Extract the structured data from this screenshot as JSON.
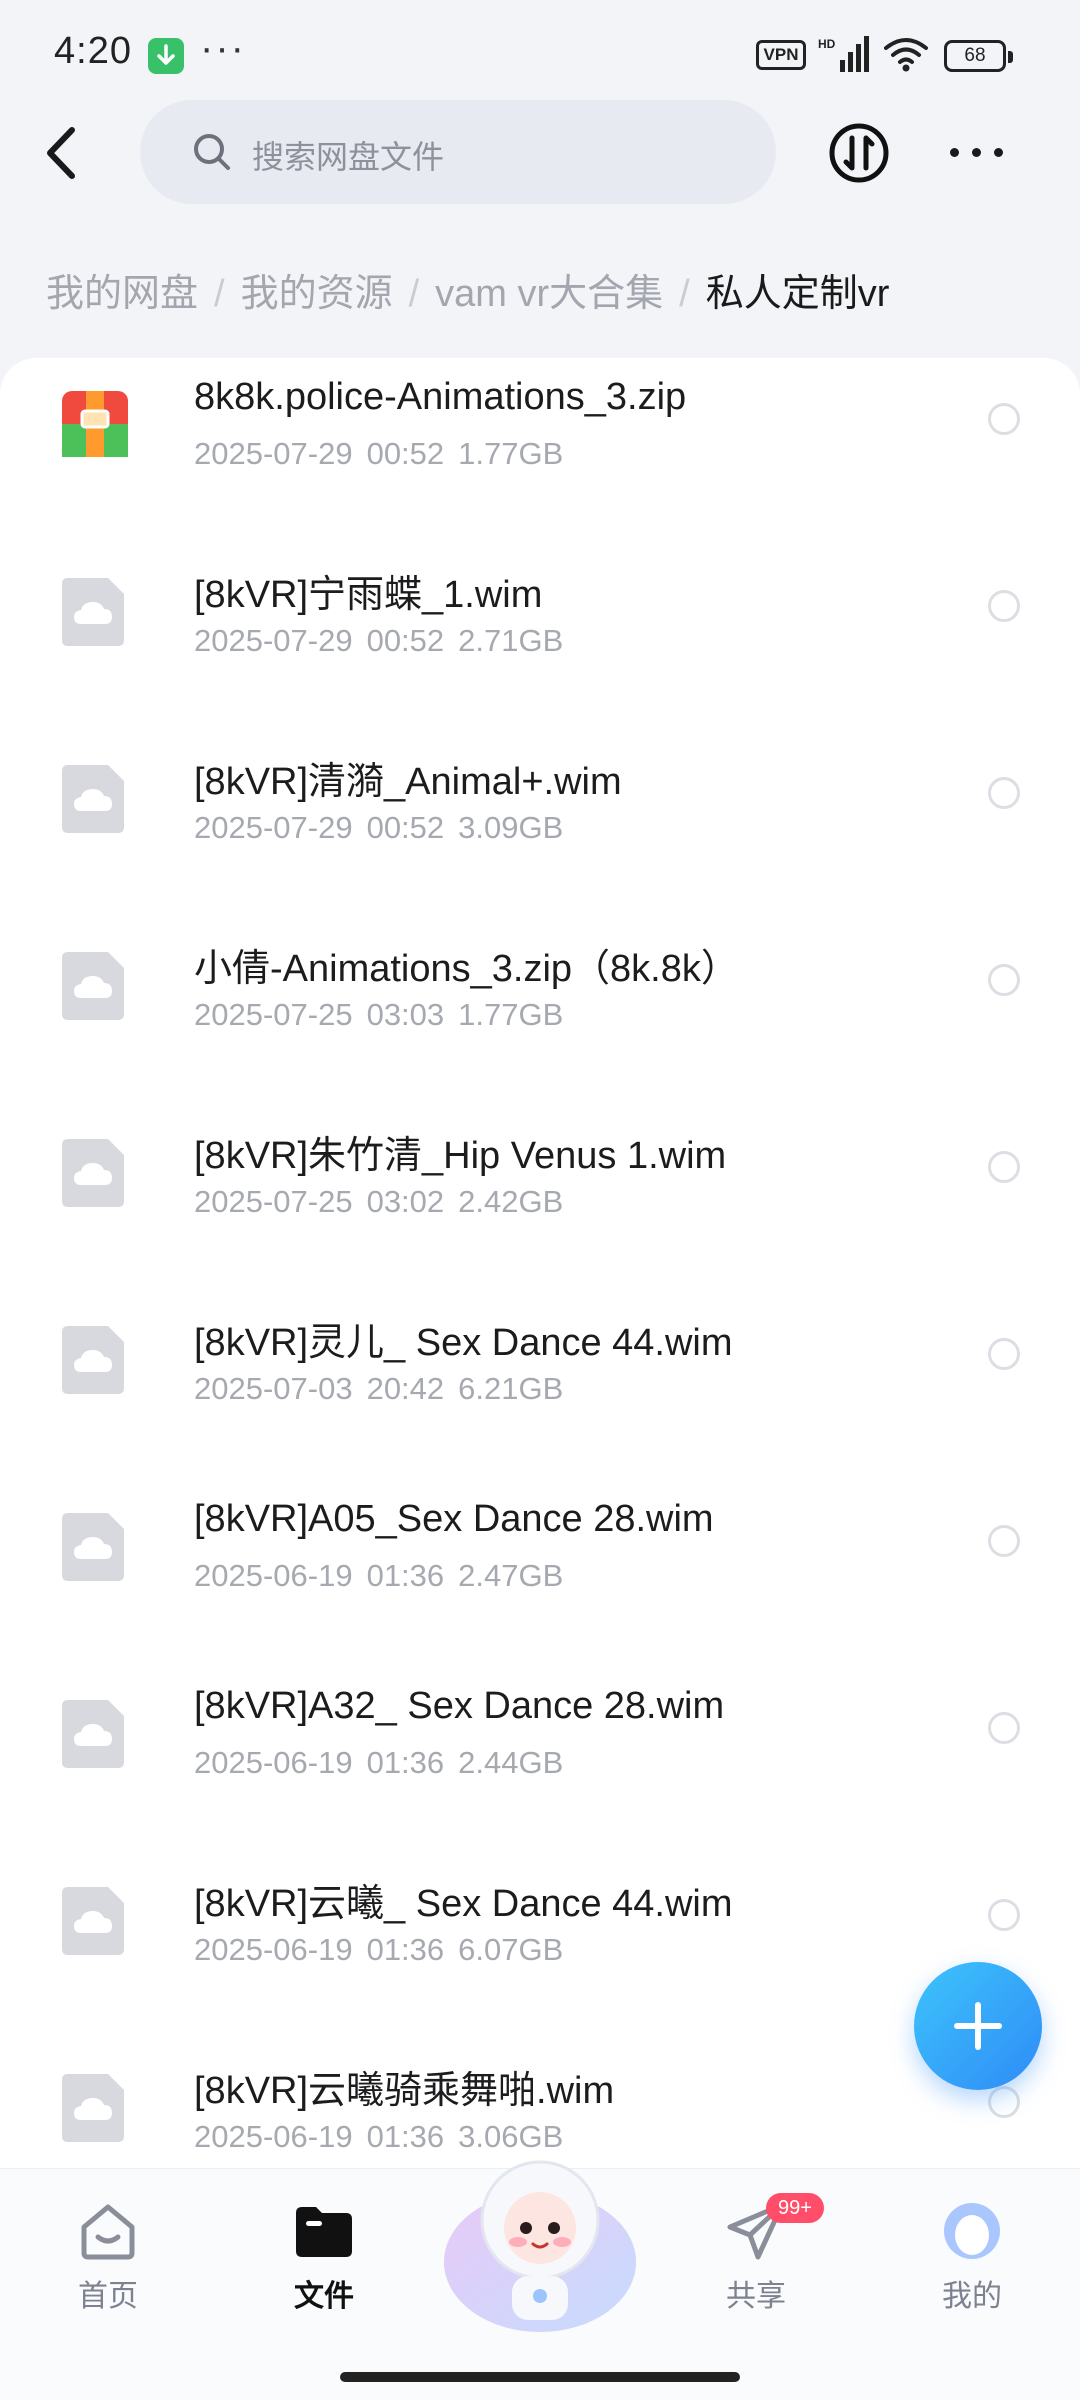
{
  "status_bar": {
    "time": "4:20",
    "vpn": "VPN",
    "battery": "68"
  },
  "header": {
    "search_placeholder": "搜索网盘文件"
  },
  "breadcrumb": {
    "items": [
      "我的网盘",
      "我的资源",
      "vam vr大合集"
    ],
    "separator": "/",
    "current": "私人定制vr"
  },
  "files": [
    {
      "name": "8k8k.police-Animations_3.zip",
      "date": "2025-07-29",
      "time": "00:52",
      "size": "1.77GB",
      "icon": "zip-archive-icon"
    },
    {
      "name": "[8kVR]宁雨蝶_1.wim",
      "date": "2025-07-29",
      "time": "00:52",
      "size": "2.71GB",
      "icon": "cloud-file-icon"
    },
    {
      "name": "[8kVR]清漪_Animal+.wim",
      "date": "2025-07-29",
      "time": "00:52",
      "size": "3.09GB",
      "icon": "cloud-file-icon"
    },
    {
      "name": "小倩-Animations_3.zip（8k.8k）",
      "date": "2025-07-25",
      "time": "03:03",
      "size": "1.77GB",
      "icon": "cloud-file-icon"
    },
    {
      "name": "[8kVR]朱竹清_Hip Venus 1.wim",
      "date": "2025-07-25",
      "time": "03:02",
      "size": "2.42GB",
      "icon": "cloud-file-icon"
    },
    {
      "name": "[8kVR]灵儿_ Sex Dance 44.wim",
      "date": "2025-07-03",
      "time": "20:42",
      "size": "6.21GB",
      "icon": "cloud-file-icon"
    },
    {
      "name": "[8kVR]A05_Sex Dance 28.wim",
      "date": "2025-06-19",
      "time": "01:36",
      "size": "2.47GB",
      "icon": "cloud-file-icon"
    },
    {
      "name": "[8kVR]A32_ Sex Dance 28.wim",
      "date": "2025-06-19",
      "time": "01:36",
      "size": "2.44GB",
      "icon": "cloud-file-icon"
    },
    {
      "name": "[8kVR]云曦_ Sex Dance 44.wim",
      "date": "2025-06-19",
      "time": "01:36",
      "size": "6.07GB",
      "icon": "cloud-file-icon"
    },
    {
      "name": "[8kVR]云曦骑乘舞啪.wim",
      "date": "2025-06-19",
      "time": "01:36",
      "size": "3.06GB",
      "icon": "cloud-file-icon"
    }
  ],
  "bottom_nav": {
    "items": [
      {
        "label": "首页",
        "icon": "home-icon",
        "active": false
      },
      {
        "label": "文件",
        "icon": "folder-icon",
        "active": true
      },
      {
        "label": "共享",
        "icon": "send-icon",
        "active": false,
        "badge": "99+"
      },
      {
        "label": "我的",
        "icon": "profile-icon",
        "active": false
      }
    ]
  },
  "colors": {
    "accent": "#2f8bf7",
    "badge": "#ff4d6a",
    "background": "#f3f4f8",
    "card": "#ffffff"
  }
}
